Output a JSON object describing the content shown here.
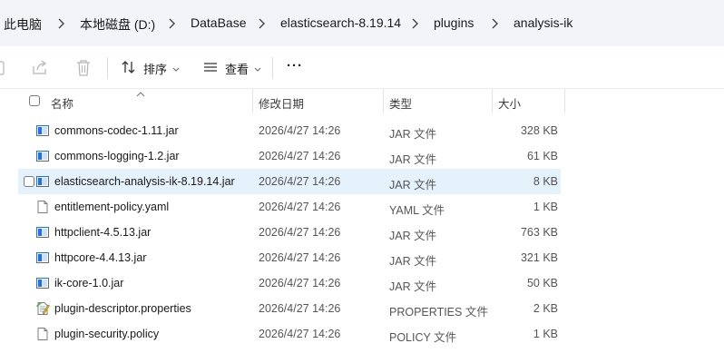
{
  "breadcrumb": {
    "items": [
      "此电脑",
      "本地磁盘 (D:)",
      "DataBase",
      "elasticsearch-8.19.14",
      "plugins",
      "analysis-ik"
    ]
  },
  "toolbar": {
    "sort_label": "排序",
    "view_label": "查看",
    "more_label": "···"
  },
  "columns": {
    "name": "名称",
    "modified": "修改日期",
    "type": "类型",
    "size": "大小"
  },
  "files": [
    {
      "name": "commons-codec-1.11.jar",
      "modified": "2026/4/27 14:26",
      "type": "JAR 文件",
      "size": "328 KB",
      "icon": "jar-file-icon"
    },
    {
      "name": "commons-logging-1.2.jar",
      "modified": "2026/4/27 14:26",
      "type": "JAR 文件",
      "size": "61 KB",
      "icon": "jar-file-icon"
    },
    {
      "name": "elasticsearch-analysis-ik-8.19.14.jar",
      "modified": "2026/4/27 14:26",
      "type": "JAR 文件",
      "size": "8 KB",
      "icon": "jar-file-icon",
      "selected": true
    },
    {
      "name": "entitlement-policy.yaml",
      "modified": "2026/4/27 14:26",
      "type": "YAML 文件",
      "size": "1 KB",
      "icon": "blank-file-icon"
    },
    {
      "name": "httpclient-4.5.13.jar",
      "modified": "2026/4/27 14:26",
      "type": "JAR 文件",
      "size": "763 KB",
      "icon": "jar-file-icon"
    },
    {
      "name": "httpcore-4.4.13.jar",
      "modified": "2026/4/27 14:26",
      "type": "JAR 文件",
      "size": "321 KB",
      "icon": "jar-file-icon"
    },
    {
      "name": "ik-core-1.0.jar",
      "modified": "2026/4/27 14:26",
      "type": "JAR 文件",
      "size": "50 KB",
      "icon": "jar-file-icon"
    },
    {
      "name": "plugin-descriptor.properties",
      "modified": "2026/4/27 14:26",
      "type": "PROPERTIES 文件",
      "size": "2 KB",
      "icon": "properties-file-icon"
    },
    {
      "name": "plugin-security.policy",
      "modified": "2026/4/27 14:26",
      "type": "POLICY 文件",
      "size": "1 KB",
      "icon": "blank-file-icon"
    }
  ],
  "colors": {
    "breadcrumb_bg": "#f3f4f8",
    "selected_row": "#e5f1fb",
    "jar_icon_blue": "#2a6fd1"
  }
}
